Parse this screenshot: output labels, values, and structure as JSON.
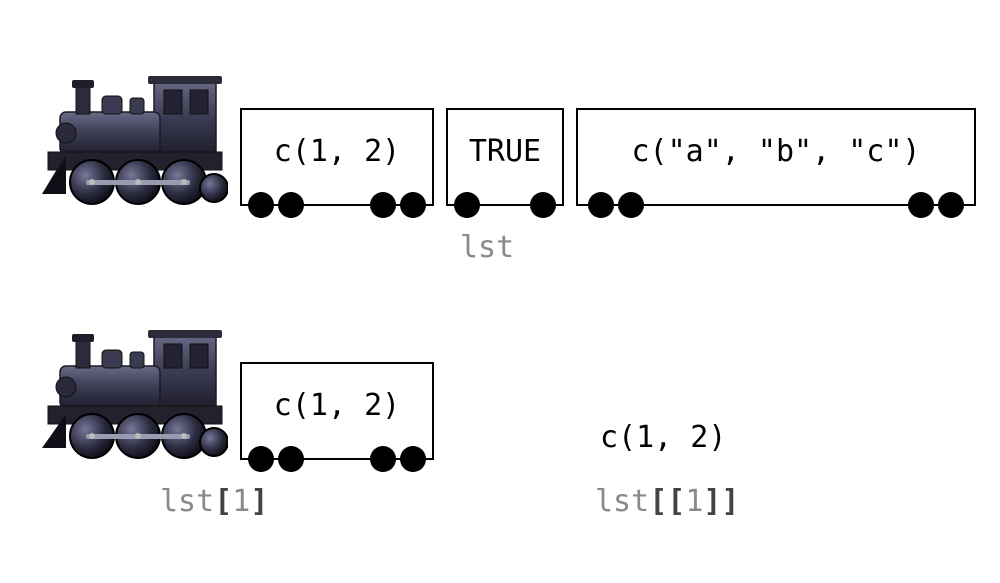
{
  "row1": {
    "cars": [
      {
        "text": "c(1, 2)"
      },
      {
        "text": "TRUE"
      },
      {
        "text": "c(\"a\", \"b\", \"c\")"
      }
    ],
    "label": "lst"
  },
  "row2": {
    "cars": [
      {
        "text": "c(1, 2)"
      }
    ],
    "label_prefix": "lst",
    "label_bracket_open": "[",
    "label_index": "1",
    "label_bracket_close": "]"
  },
  "bare": {
    "value": "c(1, 2)",
    "label_prefix": "lst",
    "label_dopen": "[[",
    "label_index": "1",
    "label_dclose": "]]"
  }
}
